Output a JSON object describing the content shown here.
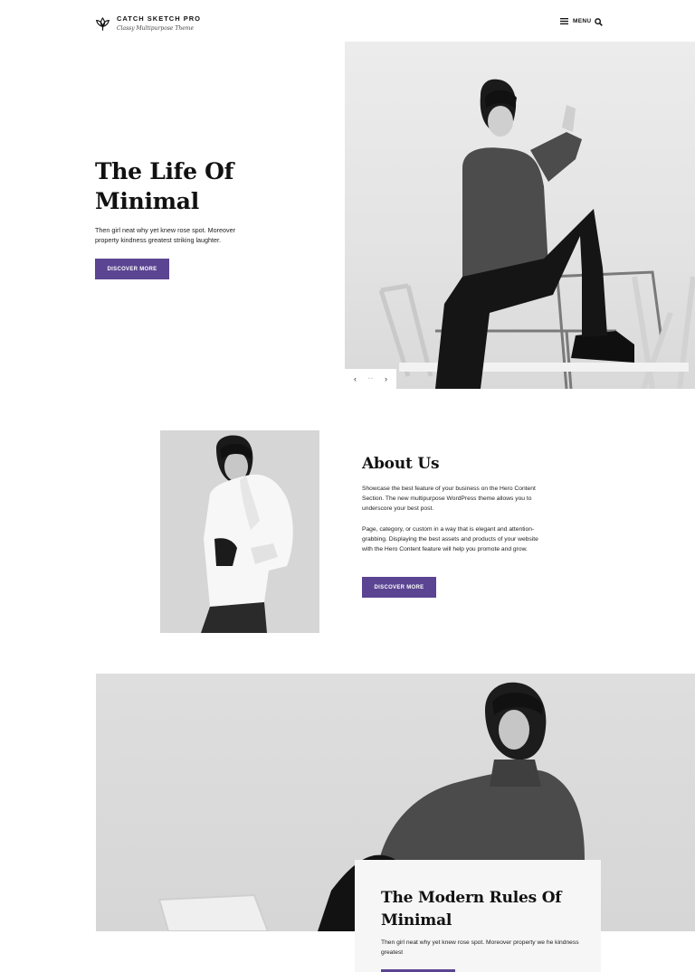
{
  "header": {
    "site_title": "CATCH SKETCH PRO",
    "tagline": "Classy Multipurpose Theme",
    "menu_label": "MENU",
    "logo_icon": "lotus-logo-icon",
    "menu_icon": "hamburger-icon",
    "search_icon": "search-icon"
  },
  "hero": {
    "title_line1": "The Life Of",
    "title_line2": "Minimal",
    "text": "Then girl neat why yet knew rose spot. Moreover property kindness greatest striking laughter.",
    "button_label": "DISCOVER MORE",
    "prev_icon": "chevron-left-icon",
    "next_icon": "chevron-right-icon",
    "prev_glyph": "‹",
    "next_glyph": "›",
    "dots": "• •"
  },
  "about": {
    "title": "About Us",
    "paragraph1": "Showcase the best feature of your business on the Hero Content Section. The new multipurpose WordPress theme allows you to underscore your best post.",
    "paragraph2": "Page, category, or custom in a way that is elegant and attention-grabbing. Displaying the best assets and products of your website with the Hero Content feature will help you promote and grow.",
    "button_label": "DISCOVER MORE"
  },
  "featured": {
    "title_line1": "The Modern Rules Of",
    "title_line2": "Minimal",
    "text": "Then girl neat why yet knew rose spot. Moreover property we he kindness greatest"
  },
  "colors": {
    "accent": "#5b4491",
    "background": "#ffffff",
    "image_gray": "#e5e5e5"
  }
}
